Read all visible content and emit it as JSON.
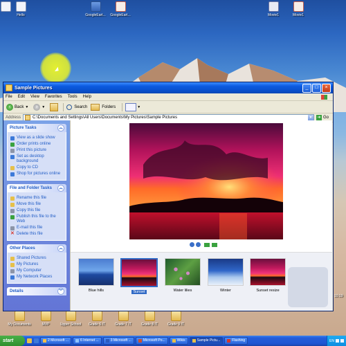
{
  "desktop": {
    "top_icons": [
      {
        "label": "",
        "icon": "document-icon"
      },
      {
        "label": "Hello",
        "icon": "document-icon"
      },
      {
        "label": "GoogleEart...",
        "icon": "google-earth-doc-icon"
      },
      {
        "label": "GoogleEart...",
        "icon": "google-earth-pdf-icon"
      },
      {
        "label": "Movie1",
        "icon": "movie-icon"
      },
      {
        "label": "Movie1",
        "icon": "movie-pdf-icon"
      }
    ],
    "bottom_icons": [
      {
        "label": "My Documents",
        "icon": "my-documents-icon"
      },
      {
        "label": "MVP",
        "icon": "folder-icon"
      },
      {
        "label": "Upper School",
        "icon": "folder-icon"
      },
      {
        "label": "Grade 6 IT",
        "icon": "folder-icon"
      },
      {
        "label": "Grade 7 IT",
        "icon": "folder-icon"
      },
      {
        "label": "Grade 8 IT",
        "icon": "folder-icon"
      },
      {
        "label": "Grade 9 IT",
        "icon": "folder-icon"
      }
    ],
    "clock_edge": "10:19"
  },
  "window": {
    "title": "Sample Pictures",
    "menu": [
      "File",
      "Edit",
      "View",
      "Favorites",
      "Tools",
      "Help"
    ],
    "toolbar": {
      "back": "Back",
      "search": "Search",
      "folders": "Folders"
    },
    "address": {
      "label": "Address",
      "path": "C:\\Documents and Settings\\All Users\\Documents\\My Pictures\\Sample Pictures",
      "go": "Go"
    },
    "panels": {
      "picture_tasks": {
        "title": "Picture Tasks",
        "items": [
          "View as a slide show",
          "Order prints online",
          "Print this picture",
          "Set as desktop background",
          "Copy to CD",
          "Shop for pictures online"
        ]
      },
      "file_folder_tasks": {
        "title": "File and Folder Tasks",
        "items": [
          "Rename this file",
          "Move this file",
          "Copy this file",
          "Publish this file to the Web",
          "E-mail this file",
          "Delete this file"
        ]
      },
      "other_places": {
        "title": "Other Places",
        "items": [
          "Shared Pictures",
          "My Pictures",
          "My Computer",
          "My Network Places"
        ]
      },
      "details": {
        "title": "Details"
      }
    },
    "thumbnails": [
      {
        "label": "Blue hills",
        "selected": false
      },
      {
        "label": "Sunset",
        "selected": true
      },
      {
        "label": "Water lilies",
        "selected": false
      },
      {
        "label": "Winter",
        "selected": false
      },
      {
        "label": "Sunset resize",
        "selected": false
      }
    ]
  },
  "taskbar": {
    "start": "start",
    "items": [
      {
        "label": "2 Microsoft ...",
        "active": false
      },
      {
        "label": "6 Internet ...",
        "active": false
      },
      {
        "label": "3 Microsoft ...",
        "active": false
      },
      {
        "label": "Microsoft Po...",
        "active": false
      },
      {
        "label": "Wikis",
        "active": false
      },
      {
        "label": "Sample Pictu...",
        "active": true
      },
      {
        "label": "Flashing",
        "active": false
      }
    ],
    "tray_lang": "EN"
  }
}
